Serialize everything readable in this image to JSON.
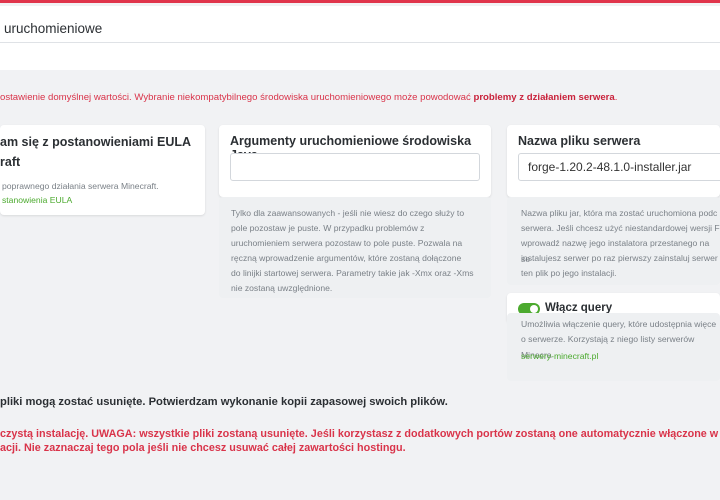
{
  "environment_select": {
    "value": "uruchomieniowe"
  },
  "warning": {
    "text": "ostawienie domyślnej wartości. Wybranie niekompatybilnego środowiska uruchomieniowego może powodować ",
    "highlight": "problemy z działaniem serwera",
    "end": "."
  },
  "eula_card": {
    "title_line1": "am się z postanowieniami EULA",
    "title_line2": "raft",
    "desc": "poprawnego działania serwera Minecraft.",
    "link": "stanowienia EULA"
  },
  "java_args_card": {
    "title": "Argumenty uruchomieniowe środowiska Java",
    "input_value": "",
    "desc_lines": [
      "Tylko dla zaawansowanych - jeśli nie wiesz do czego służy to",
      "pole pozostaw je puste. W przypadku problemów z",
      "uruchomieniem serwera pozostaw to pole puste. Pozwala na",
      "ręczną wprowadzenie argumentów, które zostaną dołączone",
      "do linijki startowej serwera. Parametry takie jak -Xmx oraz -Xms",
      "nie zostaną uwzględnione."
    ]
  },
  "server_file_card": {
    "title": "Nazwa pliku serwera",
    "input_value": "forge-1.20.2-48.1.0-installer.jar",
    "desc_lines": [
      "Nazwa pliku jar, która ma zostać uruchomiona podc",
      "serwera. Jeśli chcesz użyć niestandardowej wersji F",
      "wprowadź nazwę jego instalatora przestanego na se",
      "instalujesz serwer po raz pierwszy zainstaluj serwer",
      "ten plik po jego instalacji."
    ]
  },
  "query_card": {
    "title": "Włącz query",
    "enabled": true,
    "desc_lines": [
      "Umożliwia włączenie query, które udostępnia więce",
      "o serwerze. Korzystają z niego listy serwerów Minecra"
    ],
    "link": "serwery-minecraft.pl"
  },
  "notices": {
    "confirm": " pliki mogą zostać usunięte. Potwierdzam wykonanie kopii zapasowej swoich plików.",
    "danger_line1": " czystą instalację. UWAGA: wszystkie pliki zostaną usunięte. Jeśli korzystasz z dodatkowych portów zostaną one automatycznie włączone w ciągu",
    "danger_line2": "acji. Nie zaznaczaj tego pola jeśli nie chcesz usuwać całej zawartości hostingu."
  },
  "colors": {
    "accent_red": "#e0344b",
    "link_green": "#4caa2f",
    "toggle_green": "#4caa2f"
  }
}
